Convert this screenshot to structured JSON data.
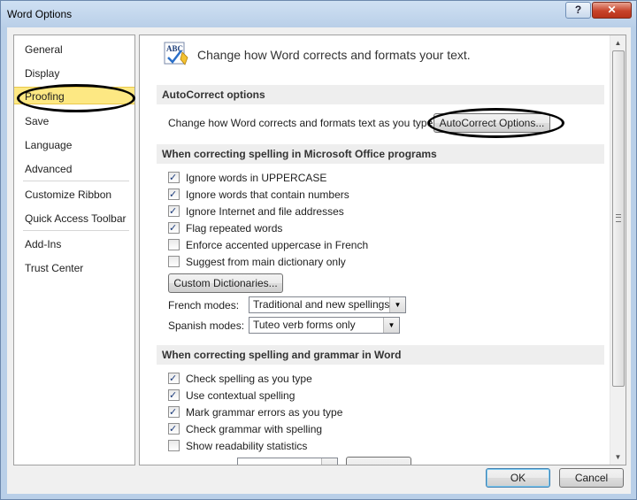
{
  "window": {
    "title": "Word Options",
    "help_label": "?",
    "close_label": "✕"
  },
  "nav": {
    "items": [
      {
        "label": "General"
      },
      {
        "label": "Display"
      },
      {
        "label": "Proofing"
      },
      {
        "label": "Save"
      },
      {
        "label": "Language"
      },
      {
        "label": "Advanced"
      },
      {
        "label": "Customize Ribbon"
      },
      {
        "label": "Quick Access Toolbar"
      },
      {
        "label": "Add-Ins"
      },
      {
        "label": "Trust Center"
      }
    ],
    "selected": "Proofing"
  },
  "header": {
    "icon": "abc-autocorrect-icon",
    "icon_text": "ABC",
    "text": "Change how Word corrects and formats your text."
  },
  "autocorrect": {
    "section_title": "AutoCorrect options",
    "description": "Change how Word corrects and formats text as you type:",
    "button_label": "AutoCorrect Options..."
  },
  "office_spelling": {
    "section_title": "When correcting spelling in Microsoft Office programs",
    "options": [
      {
        "label": "Ignore words in UPPERCASE",
        "checked": true
      },
      {
        "label": "Ignore words that contain numbers",
        "checked": true
      },
      {
        "label": "Ignore Internet and file addresses",
        "checked": true
      },
      {
        "label": "Flag repeated words",
        "checked": true
      },
      {
        "label": "Enforce accented uppercase in French",
        "checked": false
      },
      {
        "label": "Suggest from main dictionary only",
        "checked": false
      }
    ],
    "custom_dictionaries_label": "Custom Dictionaries...",
    "french_modes_label": "French modes:",
    "french_modes_value": "Traditional and new spellings",
    "spanish_modes_label": "Spanish modes:",
    "spanish_modes_value": "Tuteo verb forms only"
  },
  "word_spelling": {
    "section_title": "When correcting spelling and grammar in Word",
    "options": [
      {
        "label": "Check spelling as you type",
        "checked": true
      },
      {
        "label": "Use contextual spelling",
        "checked": true
      },
      {
        "label": "Mark grammar errors as you type",
        "checked": true
      },
      {
        "label": "Check grammar with spelling",
        "checked": true
      },
      {
        "label": "Show readability statistics",
        "checked": false
      }
    ]
  },
  "footer": {
    "ok_label": "OK",
    "cancel_label": "Cancel"
  },
  "colors": {
    "selected_nav": "#fde883",
    "annotation_oval": "#000000"
  }
}
